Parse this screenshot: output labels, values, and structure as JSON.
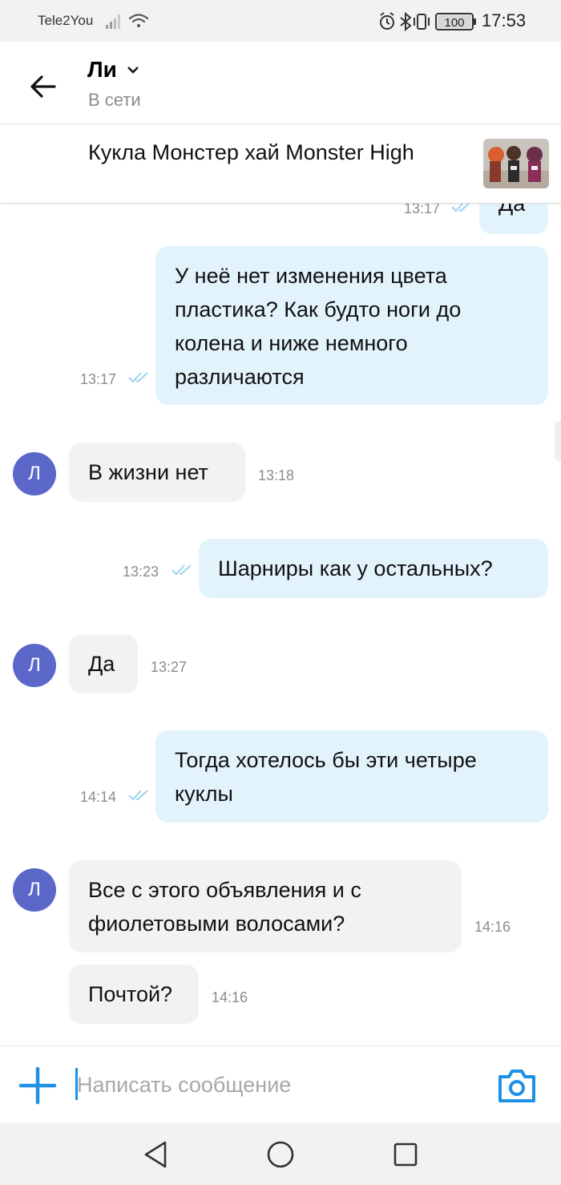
{
  "status_bar": {
    "carrier": "Tele2You",
    "battery": "100",
    "time": "17:53"
  },
  "header": {
    "name": "Ли",
    "status": "В сети"
  },
  "listing": {
    "title": "Кукла Монстер хай Monster High"
  },
  "messages": [
    {
      "dir": "out",
      "text": "Да",
      "time": "13:17",
      "read": true
    },
    {
      "dir": "out",
      "text": "У неё нет изменения цвета пластика? Как будто ноги до колена и ниже немного различаются",
      "time": "13:17",
      "read": true
    },
    {
      "dir": "in",
      "text": "В жизни нет",
      "time": "13:18",
      "avatar": "Л"
    },
    {
      "dir": "out",
      "text": "Шарниры как у остальных?",
      "time": "13:23",
      "read": true
    },
    {
      "dir": "in",
      "text": "Да",
      "time": "13:27",
      "avatar": "Л"
    },
    {
      "dir": "out",
      "text": "Тогда хотелось бы эти четыре куклы",
      "time": "14:14",
      "read": true
    },
    {
      "dir": "in",
      "text": "Все с этого объявления и с фиолетовыми волосами?",
      "time": "14:16",
      "avatar": "Л"
    },
    {
      "dir": "in",
      "text": "Почтой?",
      "time": "14:16"
    }
  ],
  "input": {
    "placeholder": "Написать сообщение",
    "value": ""
  },
  "colors": {
    "accent": "#1e90e6",
    "outgoing_bubble": "#e3f3fc",
    "incoming_bubble": "#f2f2f2",
    "avatar": "#5b68c9",
    "read_ticks": "#9fd3ee"
  }
}
